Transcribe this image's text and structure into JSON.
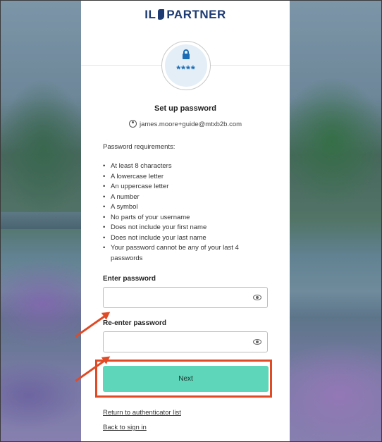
{
  "brand": {
    "logo_left": "IL",
    "logo_right": "PARTNER",
    "color": "#1d3b72"
  },
  "badge": {
    "icon": "unlocked-padlock-icon",
    "text": "****"
  },
  "page": {
    "title": "Set up password",
    "username": "james.moore+guide@mtxb2b.com"
  },
  "requirements": {
    "heading": "Password requirements:",
    "items": [
      "At least 8 characters",
      "A lowercase letter",
      "An uppercase letter",
      "A number",
      "A symbol",
      "No parts of your username",
      "Does not include your first name",
      "Does not include your last name",
      "Your password cannot be any of your last 4 passwords"
    ]
  },
  "form": {
    "password_label": "Enter password",
    "password_value": "",
    "confirm_label": "Re-enter password",
    "confirm_value": "",
    "next_label": "Next"
  },
  "links": {
    "return": "Return to authenticator list",
    "back": "Back to sign in"
  },
  "colors": {
    "accent_button": "#5dd6b9",
    "annotation": "#e04a25"
  }
}
